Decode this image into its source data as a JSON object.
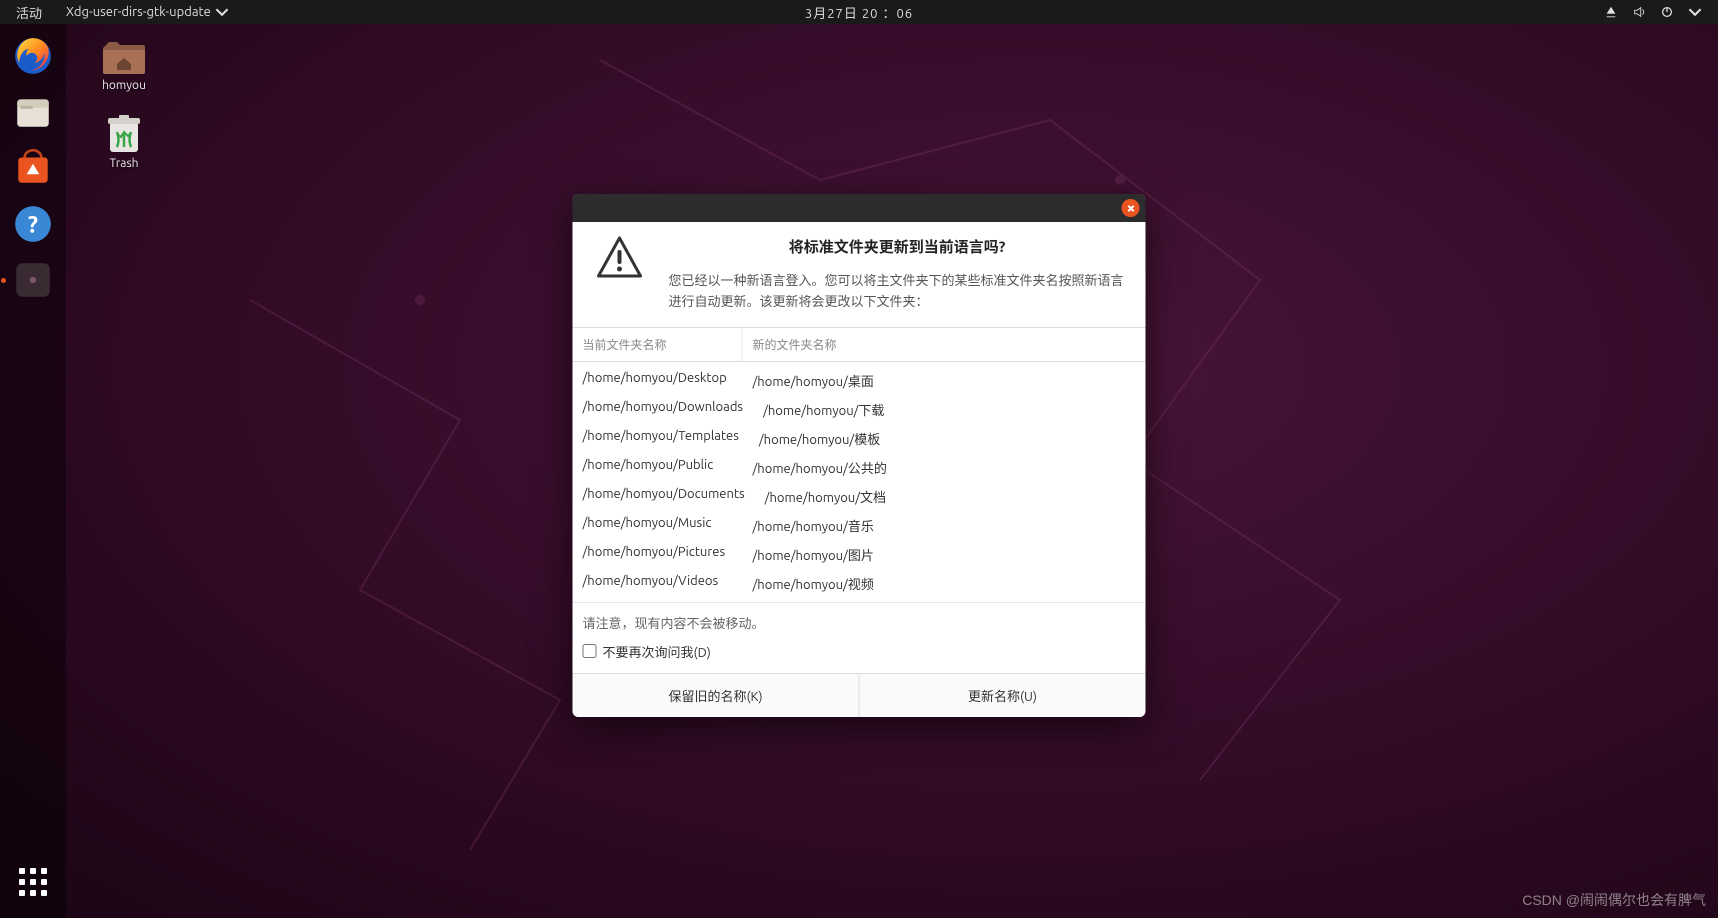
{
  "topbar": {
    "activities": "活动",
    "appmenu": "Xdg-user-dirs-gtk-update",
    "datetime": "3月27日 20 ：06"
  },
  "dock": {
    "items": [
      {
        "name": "firefox"
      },
      {
        "name": "files"
      },
      {
        "name": "software"
      },
      {
        "name": "help"
      },
      {
        "name": "running-app"
      }
    ]
  },
  "desktop": {
    "icons": [
      {
        "label": "homyou",
        "type": "home-folder"
      },
      {
        "label": "Trash",
        "type": "trash"
      }
    ]
  },
  "dialog": {
    "title": "将标准文件夹更新到当前语言吗?",
    "body": "您已经以一种新语言登入。您可以将主文件夹下的某些标准文件夹名按照新语言进行自动更新。该更新将会更改以下文件夹：",
    "col_old": "当前文件夹名称",
    "col_new": "新的文件夹名称",
    "rows": [
      {
        "old": "/home/homyou/Desktop",
        "new": "/home/homyou/桌面"
      },
      {
        "old": "/home/homyou/Downloads",
        "new": "/home/homyou/下载"
      },
      {
        "old": "/home/homyou/Templates",
        "new": "/home/homyou/模板"
      },
      {
        "old": "/home/homyou/Public",
        "new": "/home/homyou/公共的"
      },
      {
        "old": "/home/homyou/Documents",
        "new": "/home/homyou/文档"
      },
      {
        "old": "/home/homyou/Music",
        "new": "/home/homyou/音乐"
      },
      {
        "old": "/home/homyou/Pictures",
        "new": "/home/homyou/图片"
      },
      {
        "old": "/home/homyou/Videos",
        "new": "/home/homyou/视频"
      }
    ],
    "note": "请注意，现有内容不会被移动。",
    "checkbox": "不要再次询问我(D)",
    "btn_keep": "保留旧的名称(K)",
    "btn_update": "更新名称(U)"
  },
  "watermark": "CSDN @闹闹偶尔也会有脾气"
}
